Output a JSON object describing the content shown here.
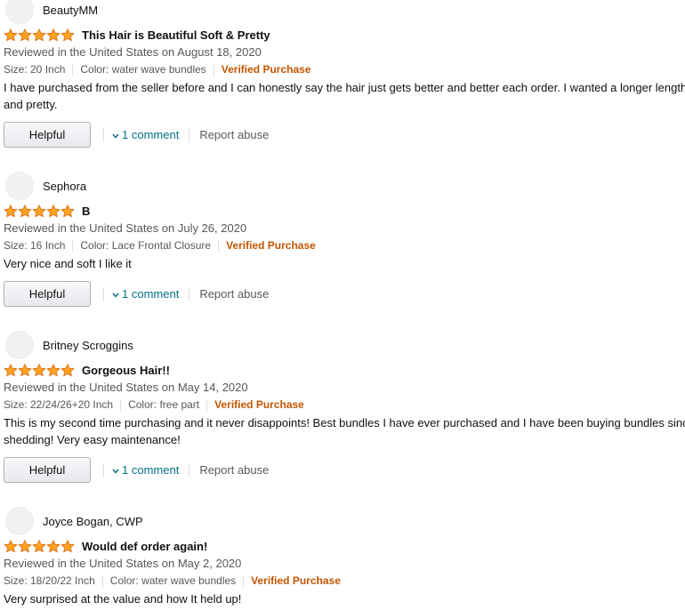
{
  "reviews": [
    {
      "profile_name": "BeautyMM",
      "rating": 5,
      "title": "This Hair is Beautiful Soft & Pretty",
      "date": "Reviewed in the United States on August 18, 2020",
      "size": "Size: 20 Inch",
      "color": "Color: water wave bundles",
      "verified": "Verified Purchase",
      "body": [
        "I have purchased from the seller before and I can honestly say the hair just gets better and better each order. I wanted a longer length and it is so soft",
        "and pretty."
      ],
      "helpful_label": "Helpful",
      "comment_label": "1 comment",
      "report_label": "Report abuse"
    },
    {
      "profile_name": "Sephora",
      "rating": 5,
      "title": "B",
      "date": "Reviewed in the United States on July 26, 2020",
      "size": "Size: 16 Inch",
      "color": "Color: Lace Frontal Closure",
      "verified": "Verified Purchase",
      "body": [
        "Very nice and soft I like it"
      ],
      "helpful_label": "Helpful",
      "comment_label": "1 comment",
      "report_label": "Report abuse"
    },
    {
      "profile_name": "Britney Scroggins",
      "rating": 5,
      "title": "Gorgeous Hair!!",
      "date": "Reviewed in the United States on May 14, 2020",
      "size": "Size: 22/24/26+20 Inch",
      "color": "Color: free part",
      "verified": "Verified Purchase",
      "body": [
        "This is my second time purchasing and it never disappoints! Best bundles I have ever purchased and I have been buying bundles since forever! No",
        "shedding! Very easy maintenance!"
      ],
      "helpful_label": "Helpful",
      "comment_label": "1 comment",
      "report_label": "Report abuse"
    },
    {
      "profile_name": "Joyce Bogan, CWP",
      "rating": 5,
      "title": "Would def order again!",
      "date": "Reviewed in the United States on May 2, 2020",
      "size": "Size: 18/20/22 Inch",
      "color": "Color: water wave bundles",
      "verified": "Verified Purchase",
      "body": [
        "Very surprised at the value and how It held up!"
      ]
    }
  ],
  "icons": {
    "star": "star-icon",
    "chevron": "chevron-down-icon",
    "avatar": "avatar"
  },
  "colors": {
    "star_fill": "#ffa41c",
    "star_stroke": "#de7921",
    "verified": "#c45500",
    "link": "#007185",
    "secondary_text": "#565959"
  }
}
